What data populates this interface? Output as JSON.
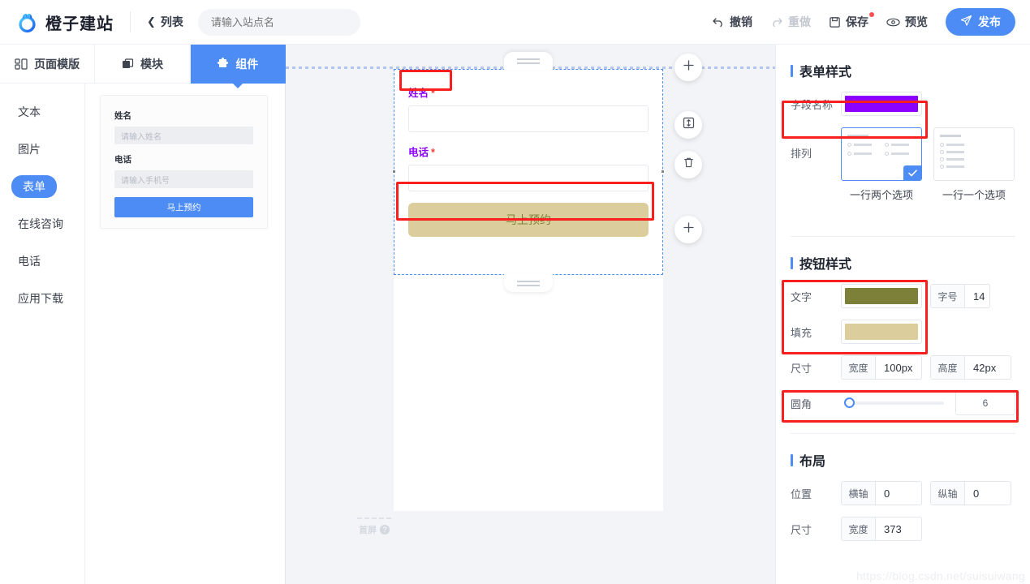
{
  "topbar": {
    "brand": "橙子建站",
    "back_label": "列表",
    "back_icon": "chevron-left-icon",
    "site_name_placeholder": "请输入站点名",
    "site_name_value": "",
    "undo_label": "撤销",
    "redo_label": "重做",
    "save_label": "保存",
    "preview_label": "预览",
    "publish_label": "发布",
    "publish_color": "#4d8bf5"
  },
  "tabs": [
    {
      "label": "页面模版",
      "icon": "template-icon",
      "active": false
    },
    {
      "label": "模块",
      "icon": "module-icon",
      "active": false
    },
    {
      "label": "组件",
      "icon": "puzzle-icon",
      "active": true
    }
  ],
  "sidebar": {
    "items": [
      {
        "label": "文本",
        "active": false
      },
      {
        "label": "图片",
        "active": false
      },
      {
        "label": "表单",
        "active": true
      },
      {
        "label": "在线咨询",
        "active": false
      },
      {
        "label": "电话",
        "active": false
      },
      {
        "label": "应用下载",
        "active": false
      }
    ]
  },
  "palette": {
    "card": {
      "name_label": "姓名",
      "name_placeholder": "请输入姓名",
      "phone_label": "电话",
      "phone_placeholder": "请输入手机号",
      "submit_label": "马上预约"
    }
  },
  "canvas": {
    "form": {
      "name_label": "姓名",
      "name_required": "*",
      "name_value": "",
      "phone_label": "电话",
      "phone_required": "*",
      "phone_value": "",
      "submit_label": "马上预约",
      "label_color": "#8B00FF",
      "button_text_color": "#7C8038",
      "button_fill_color": "#DCCE9C",
      "button_radius": "6"
    },
    "first_screen_label": "首屏",
    "help_icon_glyph": "?",
    "fabs": [
      {
        "name": "add-above-button",
        "icon": "plus-icon"
      },
      {
        "name": "resize-height-button",
        "icon": "height-adjust-icon"
      },
      {
        "name": "delete-button",
        "icon": "trash-icon"
      },
      {
        "name": "add-below-button",
        "icon": "plus-icon"
      }
    ]
  },
  "right_panel": {
    "form_style": {
      "title": "表单样式",
      "field_name_label": "字段名称",
      "field_name_color": "#8B00FF",
      "arrange_label": "排列",
      "options": [
        {
          "caption": "一行两个选项",
          "selected": true
        },
        {
          "caption": "一行一个选项",
          "selected": false
        }
      ]
    },
    "button_style": {
      "title": "按钮样式",
      "text_label": "文字",
      "text_color": "#7C8038",
      "fill_label": "填充",
      "fill_color": "#DCCE9C",
      "fontsize_label": "字号",
      "fontsize_value": "14",
      "size_label": "尺寸",
      "width_label": "宽度",
      "width_value": "100px",
      "height_label": "高度",
      "height_value": "42px",
      "radius_label": "圆角",
      "radius_value": "6"
    },
    "layout": {
      "title": "布局",
      "position_label": "位置",
      "x_label": "横轴",
      "x_value": "0",
      "y_label": "纵轴",
      "y_value": "0",
      "size_label": "尺寸",
      "width_label": "宽度",
      "width_value": "373"
    }
  },
  "watermark": "https://blog.csdn.net/suisuiwang"
}
